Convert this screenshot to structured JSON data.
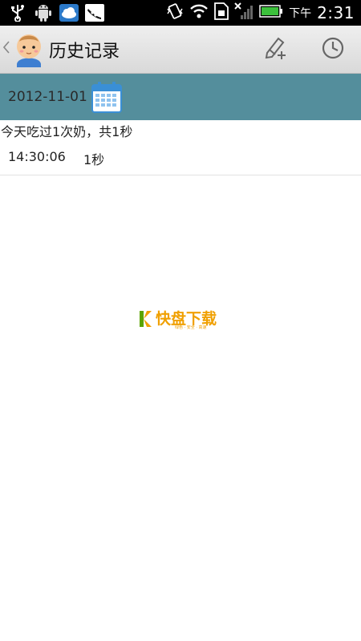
{
  "status_bar": {
    "time_period": "下午",
    "time": "2:31",
    "icons": [
      "usb-icon",
      "android-debug-icon",
      "weather-icon",
      "peapod-app-icon",
      "vibrate-icon",
      "wifi-icon",
      "sim-icon",
      "signal-icon",
      "battery-icon"
    ],
    "battery_color": "#3cc13c"
  },
  "action_bar": {
    "title": "历史记录",
    "icons": [
      "back-chevron-icon",
      "baby-avatar-icon",
      "edit-add-icon",
      "clock-icon"
    ]
  },
  "date_header": {
    "date": "2012-11-01",
    "band_color": "#548e9c",
    "icon": "calendar-icon"
  },
  "summary": "今天吃过1次奶，共1秒",
  "records": [
    {
      "time": "14:30:06",
      "duration": "1秒"
    }
  ],
  "watermark": {
    "brand": "快盘下载",
    "tagline": "绿色 · 安全 · 高速",
    "color_orange": "#f0a000",
    "color_green": "#5ba400"
  }
}
